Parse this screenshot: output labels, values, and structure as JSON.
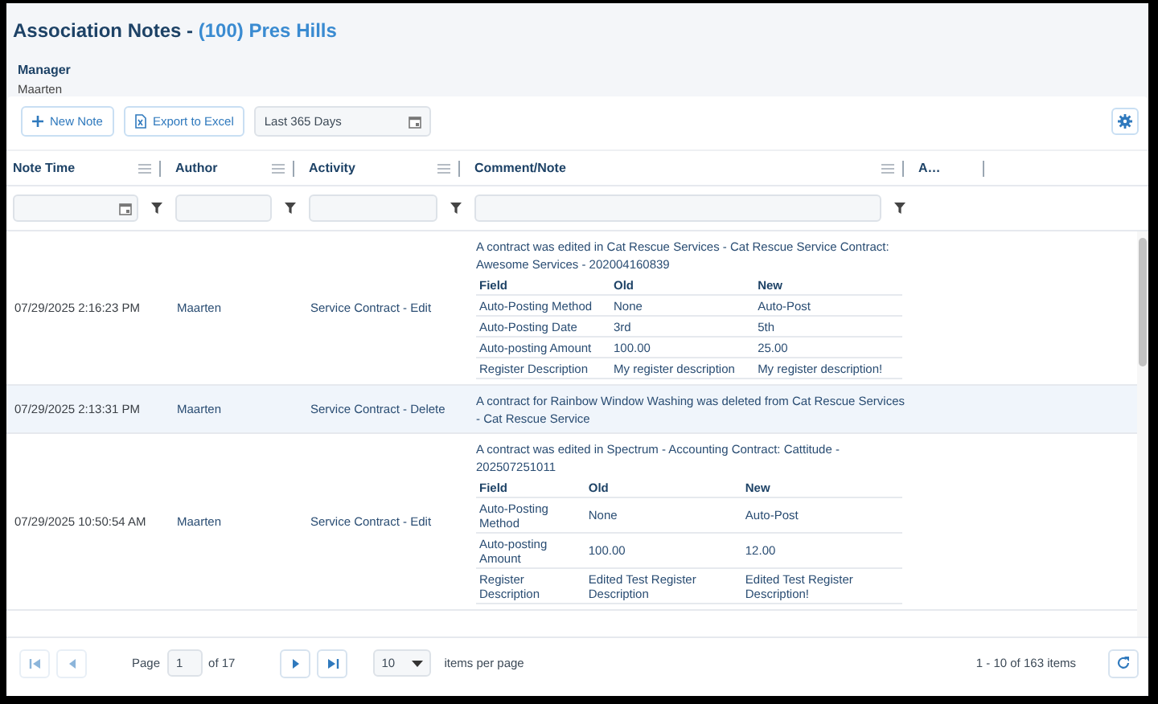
{
  "header": {
    "title": "Association Notes -",
    "title_link": "(100) Pres Hills",
    "manager_label": "Manager",
    "manager_name": "Maarten"
  },
  "toolbar": {
    "buttons": [
      {
        "label": "New Note"
      },
      {
        "label": "Export to Excel"
      }
    ],
    "date_range": "Last 365 Days"
  },
  "columns": [
    {
      "label": "Note Time",
      "kind": "date"
    },
    {
      "label": "Author",
      "kind": "text"
    },
    {
      "label": "Activity",
      "kind": "text"
    },
    {
      "label": "Comment/Note",
      "kind": "text"
    },
    {
      "label": "A…",
      "kind": "plain"
    }
  ],
  "rows": [
    {
      "note_time": "07/29/2025 2:16:23 PM",
      "author": "Maarten",
      "activity": "Service Contract - Edit",
      "selected": false,
      "comment": "A contract was edited in Cat Rescue Services - Cat Rescue Service Contract: Awesome Services - 202004160839",
      "changes": {
        "columns": [
          "Field",
          "Old",
          "New"
        ],
        "rows": [
          [
            "Auto-Posting Method",
            "None",
            "Auto-Post"
          ],
          [
            "Auto-Posting Date",
            "3rd",
            "5th"
          ],
          [
            "Auto-posting Amount",
            "100.00",
            "25.00"
          ],
          [
            "Register Description",
            "My register description",
            "My register description!"
          ]
        ]
      }
    },
    {
      "note_time": "07/29/2025 2:13:31 PM",
      "author": "Maarten",
      "activity": "Service Contract - Delete",
      "selected": true,
      "comment": "A contract for Rainbow Window Washing was deleted from Cat Rescue Services - Cat Rescue Service"
    },
    {
      "note_time": "07/29/2025 10:50:54 AM",
      "author": "Maarten",
      "activity": "Service Contract - Edit",
      "selected": false,
      "comment": "A contract was edited in Spectrum - Accounting Contract: Cattitude - 202507251011",
      "changes": {
        "columns": [
          "Field",
          "Old",
          "New"
        ],
        "rows": [
          [
            "Auto-Posting Method",
            "None",
            "Auto-Post"
          ],
          [
            "Auto-posting Amount",
            "100.00",
            "12.00"
          ],
          [
            "Register Description",
            "Edited Test Register Description",
            "Edited Test Register Description!"
          ]
        ]
      }
    }
  ],
  "pager": {
    "nav": [
      {
        "kind": "first",
        "disabled": true
      },
      {
        "kind": "prev",
        "disabled": true
      },
      {
        "kind": "next",
        "disabled": false
      },
      {
        "kind": "last",
        "disabled": false
      }
    ],
    "page_label": "Page",
    "page": "1",
    "page_count": "of 17",
    "page_size": "10",
    "page_size_label": "items per page",
    "summary": "1 - 10 of 163 items"
  }
}
